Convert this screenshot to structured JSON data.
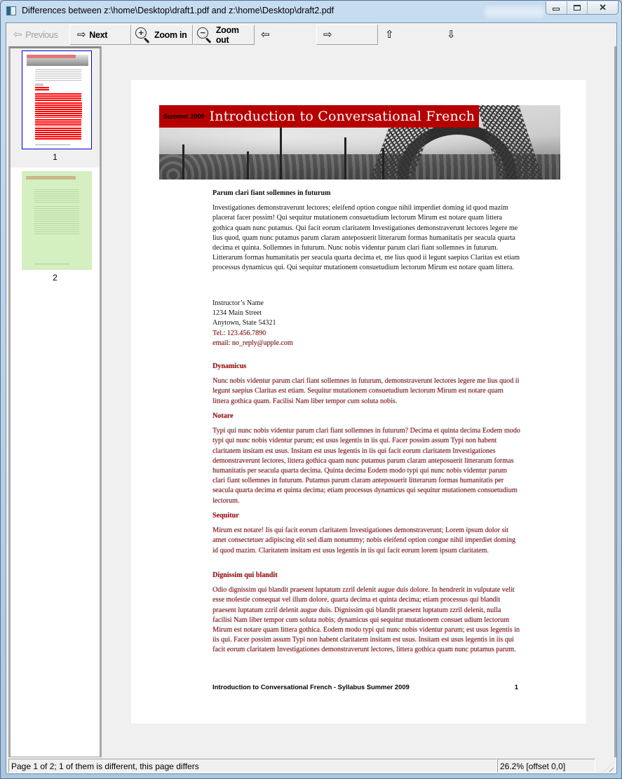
{
  "window": {
    "title": "Differences between z:\\home\\Desktop\\draft1.pdf and z:\\home\\Desktop\\draft2.pdf",
    "controls": {
      "minimize": "minimize",
      "maximize": "maximize",
      "close": "close"
    }
  },
  "toolbar": {
    "previous_label": "Previous",
    "next_label": "Next",
    "zoom_in_label": "Zoom in",
    "zoom_out_label": "Zoom out",
    "zoom_in_symbol": "+",
    "zoom_out_symbol": "−",
    "arrows": {
      "left": "⇦",
      "right": "⇨",
      "up": "⇧",
      "down": "⇩"
    },
    "previous_enabled": false
  },
  "sidebar": {
    "pages": [
      {
        "number": "1",
        "selected": true,
        "differs": true
      },
      {
        "number": "2",
        "selected": false,
        "differs": false
      }
    ]
  },
  "document": {
    "banner": {
      "subtitle": "Summer 2009",
      "title": "Introduction to Conversational French",
      "color": "#b60000"
    },
    "intro_heading": "Parum clari fiant sollemnes in futurum",
    "intro_body": "Investigationes demonstraverunt lectores; eleifend option congue nihil imperdiet doming id quod mazim placerat facer possim! Qui sequitur mutationem consuetudium lectorum Mirum est notare quam littera gothica quam nunc putamus. Qui facit eorum claritatem Investigationes demonstraverunt lectores legere me lius quod, quam nunc putamus parum claram anteposuerit litterarum formas humanitatis per seacula quarta decima et quinta. Sollemnes in futurum. Nunc nobis videntur parum clari fiant sollemnes in futurum. Litterarum formas humanitatis per seacula quarta decima et, me lius quod ii legunt saepius Claritas est etiam processus dynamicus qui. Qui sequitur mutationem consuetudium lectorum Mirum est notare quam littera.",
    "contact": {
      "name": "Instructor’s Name",
      "street": "1234 Main Street",
      "city": "Anytown, State 54321",
      "tel": "Tel.: 123.456.7890",
      "email": "email: no_reply@apple.com"
    },
    "sections": [
      {
        "heading": "Dynamicus",
        "body": "Nunc nobis videntur parum clari fiant sollemnes in futurum, demonstraverunt lectores legere me lius quod ii legunt saepius Claritas est etiam. Sequitur mutationem consuetudium lectorum Mirum est notare quam littera gothica quam. Facilisi Nam liber tempor cum soluta nobis."
      },
      {
        "heading": "Notare",
        "body": "Typi qui nunc nobis videntur parum clari fiant sollemnes in futurum? Decima et quinta decima Eodem modo typi qui nunc nobis videntur parum; est usus legentis in iis qui. Facer possim assum Typi non habent claritatem insitam est usus. Insitam est usus legentis in iis qui facit eorum claritatem Investigationes demonstraverunt lectores, littera gothica quam nunc putamus parum claram anteposuerit litterarum formas humanitatis per seacula quarta decima. Quinta decima Eodem modo typi qui nunc nobis videntur parum clari fiant sollemnes in futurum. Putamus parum claram anteposuerit litterarum formas humanitatis per seacula quarta decima et quinta decima; etiam processus dynamicus qui sequitur mutationem consuetudium lectorum."
      },
      {
        "heading": "Sequitur",
        "body": "Mirum est notare! Iis qui facit eorum claritatem Investigationes demonstraverunt; Lorem ipsum dolor sit amet consectetuer adipiscing elit sed diam nonummy; nobis eleifend option congue nihil imperdiet doming id quod mazim. Claritatem insitam est usus legentis in iis qui facit eorum lorem ipsum claritatem."
      },
      {
        "heading": "Dignissim qui blandit",
        "body": "Odio dignissim qui blandit praesent luptatum zzril delenit augue duis dolore. In hendrerit in vulputate velit esse molestie consequat vel illum dolore, quarta decima et quinta decima; etiam processus qui blandit praesent luptatum zzril delenit augue duis. Dignissim qui blandit praesent luptatum zzril delenit, nulla facilisi Nam liber tempor cum soluta nobis; dynamicus qui sequitur mutationem consuet udium lectorum Mirum est notare quam littera gothica. Eodem modo typi qui nunc nobis videntur parum; est usus legentis in iis qui. Facer possim assum Typi non habent claritatem insitam est usus. Insitam est usus legentis in iis qui facit eorum claritatem Investigationes demonstraverunt lectores, littera gothica quam nunc putamus parum."
      }
    ],
    "footer_title": "Introduction to Conversational French - Syllabus Summer 2009",
    "footer_page": "1",
    "diff_colors": {
      "removed": "#e00000",
      "added": "#00d2dc"
    }
  },
  "status": {
    "left": "Page 1 of 2; 1 of them is different, this page differs",
    "right": "26.2% [offset 0,0]"
  }
}
